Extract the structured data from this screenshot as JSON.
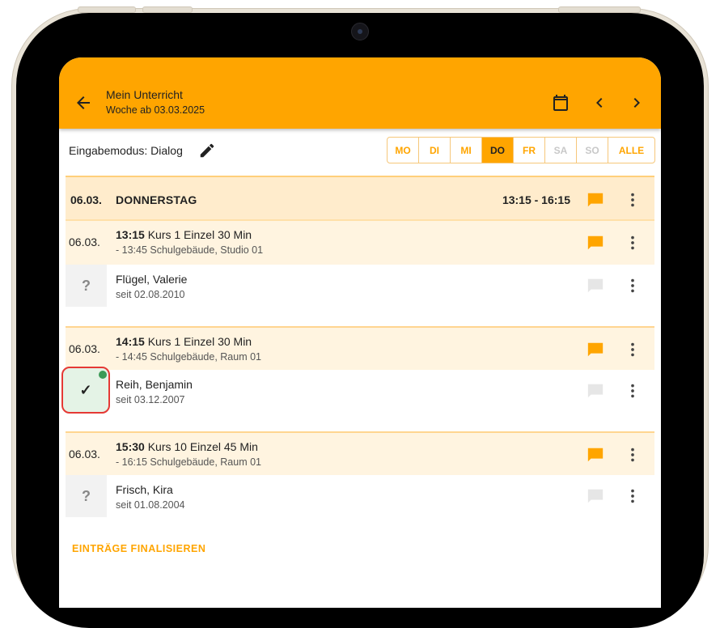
{
  "appbar": {
    "title": "Mein Unterricht",
    "subtitle": "Woche ab 03.03.2025",
    "icons": [
      "arrow-back-icon",
      "calendar-icon",
      "chevron-left-icon",
      "chevron-right-icon"
    ]
  },
  "mode": {
    "label": "Eingabemodus: Dialog",
    "icon": "pencil-icon"
  },
  "days": [
    {
      "label": "MO",
      "state": "enabled"
    },
    {
      "label": "DI",
      "state": "enabled"
    },
    {
      "label": "MI",
      "state": "enabled"
    },
    {
      "label": "DO",
      "state": "active"
    },
    {
      "label": "FR",
      "state": "enabled"
    },
    {
      "label": "SA",
      "state": "disabled"
    },
    {
      "label": "SO",
      "state": "disabled"
    },
    {
      "label": "ALLE",
      "state": "enabled"
    }
  ],
  "day_header": {
    "date": "06.03.",
    "weekday": "DONNERSTAG",
    "time": "13:15 - 16:15"
  },
  "lessons": [
    {
      "date": "06.03.",
      "start": "13:15",
      "title": "Kurs 1 Einzel 30 Min",
      "details": "- 13:45 Schulgebäude, Studio 01",
      "student": {
        "status_symbol": "?",
        "name": "Flügel, Valerie",
        "since": "seit 02.08.2010"
      }
    },
    {
      "date": "06.03.",
      "start": "14:15",
      "title": "Kurs 1 Einzel 30 Min",
      "details": "- 14:45 Schulgebäude, Raum 01",
      "student": {
        "status_symbol": "✓",
        "name": "Reih, Benjamin",
        "since": "seit 03.12.2007"
      }
    },
    {
      "date": "06.03.",
      "start": "15:30",
      "title": "Kurs 10 Einzel 45 Min",
      "details": "- 16:15 Schulgebäude, Raum 01",
      "student": {
        "status_symbol": "?",
        "name": "Frisch, Kira",
        "since": "seit 01.08.2004"
      }
    }
  ],
  "finalize_label": "EINTRÄGE FINALISIEREN",
  "colors": {
    "accent": "#ffa500",
    "header_bg": "#ffeccc",
    "lesson_bg": "#fff4e0",
    "present_bg": "#e4f3e6",
    "highlight": "#e53935",
    "comment_inactive": "#e6e6e6"
  }
}
